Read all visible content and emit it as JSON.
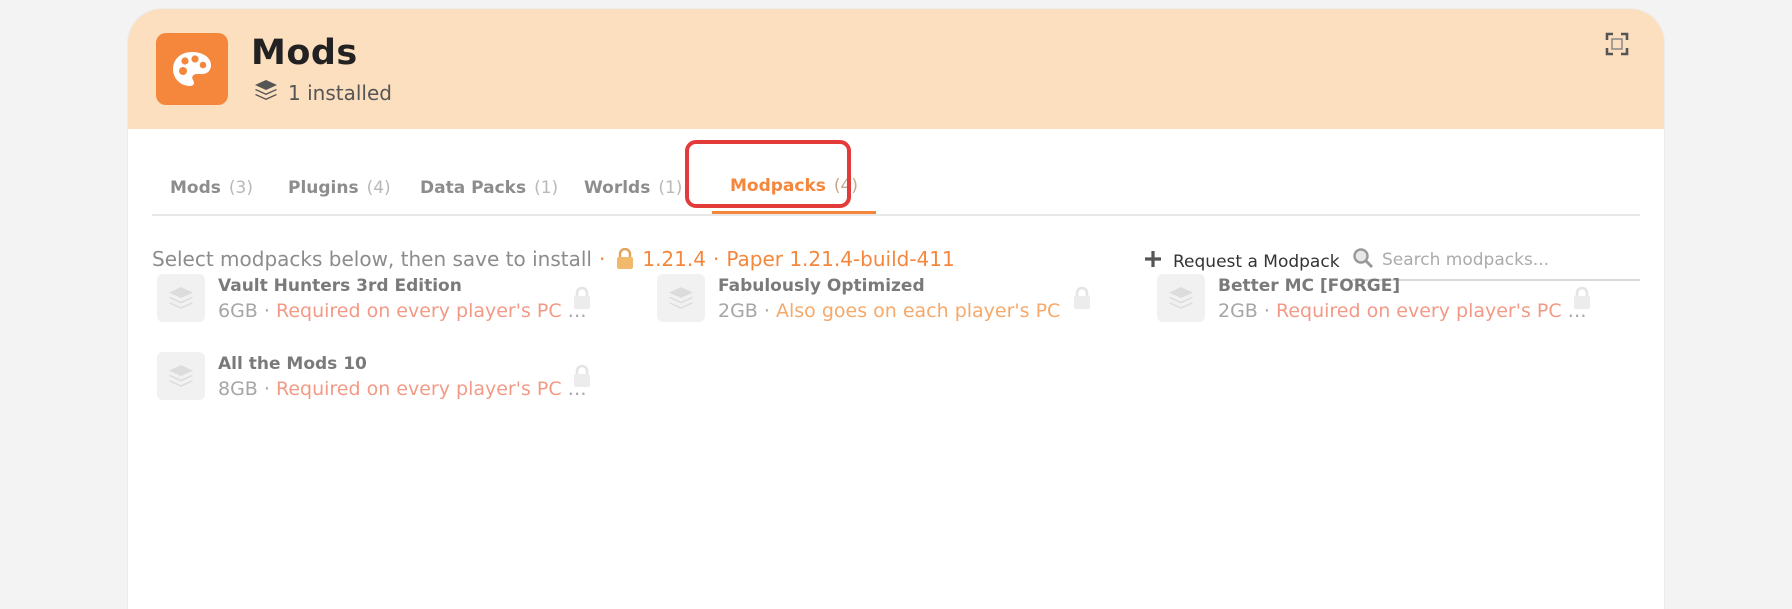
{
  "header": {
    "title": "Mods",
    "installed_text": "1 installed",
    "app_icon": "palette-icon",
    "installed_icon": "layers-icon",
    "fullscreen_icon": "fullscreen-icon"
  },
  "tabs": [
    {
      "label": "Mods",
      "count": "(3)"
    },
    {
      "label": "Plugins",
      "count": "(4)"
    },
    {
      "label": "Data Packs",
      "count": "(1)"
    },
    {
      "label": "Worlds",
      "count": "(1)"
    },
    {
      "label": "Modpacks",
      "count": "(4)",
      "active": true
    }
  ],
  "info": {
    "instruction": "Select modpacks below, then save to install",
    "separator": "·",
    "lock_icon": "lock-icon",
    "version": "1.21.4",
    "server": "Paper 1.21.4-build-411"
  },
  "request": {
    "label": "Request a Modpack",
    "icon": "plus-icon"
  },
  "search": {
    "placeholder": "Search modpacks...",
    "value": "",
    "icon": "search-icon"
  },
  "modpacks": [
    {
      "name": "Vault Hunters 3rd Edition",
      "size": "6GB",
      "sep": " · ",
      "note": "Required on every player's PC to join"
    },
    {
      "name": "Fabulously Optimized",
      "size": "2GB",
      "sep": " · ",
      "note": "Also goes on each player's PC"
    },
    {
      "name": "Better MC [FORGE]",
      "size": "2GB",
      "sep": " · ",
      "note": "Required on every player's PC to join"
    },
    {
      "name": "All the Mods 10",
      "size": "8GB",
      "sep": " · ",
      "note": "Required on every player's PC to join"
    }
  ],
  "colors": {
    "accent": "#f5873d",
    "header_bg": "#fcdfbf",
    "highlight": "#e33a3a"
  }
}
